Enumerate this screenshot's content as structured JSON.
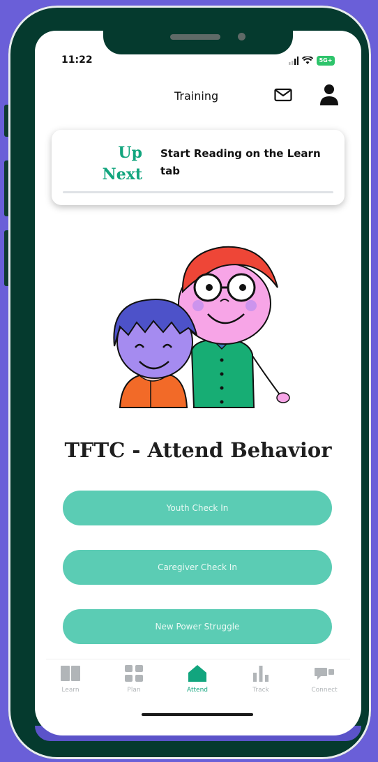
{
  "status_bar": {
    "time": "11:22",
    "battery": "5G+"
  },
  "header": {
    "title": "Training"
  },
  "up_next": {
    "label_line1": "Up",
    "label_line2": "Next",
    "message": "Start Reading on the Learn tab"
  },
  "page_title": "TFTC - Attend Behavior",
  "actions": [
    {
      "label": "Youth Check In"
    },
    {
      "label": "Caregiver Check In"
    },
    {
      "label": "New Power Struggle"
    }
  ],
  "tabs": [
    {
      "label": "Learn",
      "icon": "book-icon"
    },
    {
      "label": "Plan",
      "icon": "grid-icon"
    },
    {
      "label": "Attend",
      "icon": "home-icon",
      "active": true
    },
    {
      "label": "Track",
      "icon": "bar-chart-icon"
    },
    {
      "label": "Connect",
      "icon": "chat-icon"
    }
  ],
  "colors": {
    "accent": "#12a57e",
    "button": "#5bccb4",
    "frame": "#053a2e",
    "background": "#6a5fd8"
  }
}
